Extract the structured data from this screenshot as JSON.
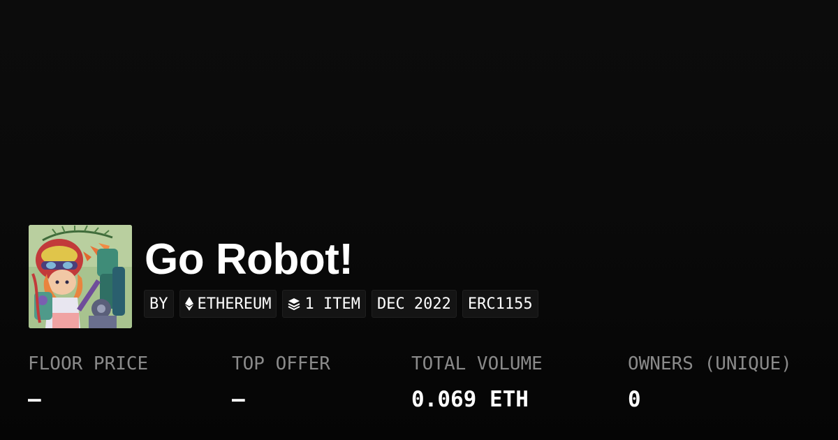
{
  "collection": {
    "title": "Go Robot!",
    "avatar_icon": "collection-artwork-robot-girl"
  },
  "chips": {
    "by": "BY",
    "chain": "ETHEREUM",
    "chain_icon": "ethereum-icon",
    "items": "1 ITEM",
    "items_icon": "layers-icon",
    "date": "DEC 2022",
    "standard": "ERC1155"
  },
  "stats": {
    "floor_price": {
      "label": "FLOOR PRICE",
      "value": "—"
    },
    "top_offer": {
      "label": "TOP OFFER",
      "value": "—"
    },
    "total_volume": {
      "label": "TOTAL VOLUME",
      "value": "0.069 ETH"
    },
    "owners": {
      "label": "OWNERS (UNIQUE)",
      "value": "0"
    }
  },
  "colors": {
    "background": "#0a0a0a",
    "chip_background": "#141414",
    "label_gray": "#8a8a8a",
    "text": "#ffffff"
  }
}
